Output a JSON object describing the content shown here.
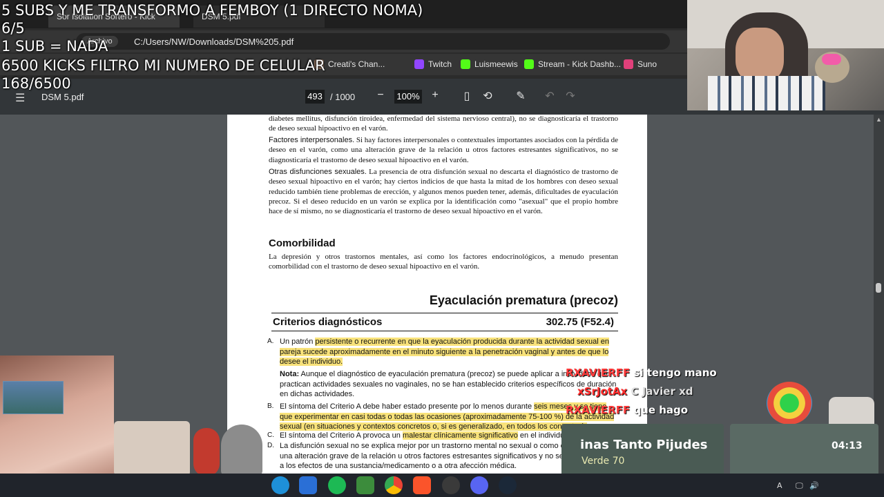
{
  "overlay": {
    "line1": "5 SUBS Y ME TRANSFORMO A FEMBOY (1 DIRECTO NOMA)",
    "line2": "6/5",
    "line3": "1 SUB = NADA",
    "line4": "6500 KICKS FILTRO MI NUMERO DE CELULAR",
    "line5": "168/6500"
  },
  "browser": {
    "tab1": "Sor Isolation Sortero - Kick",
    "tab2": "DSM 5.pdf",
    "chip": "Archivo",
    "url": "C:/Users/NW/Downloads/DSM%205.pdf",
    "bookmarks": [
      "Creati's Chan...",
      "Twitch",
      "Luismeewis",
      "Stream - Kick Dashb...",
      "Suno"
    ]
  },
  "pdf_toolbar": {
    "title": "DSM 5.pdf",
    "page_current": "493",
    "page_total": "/ 1000",
    "zoom": "100%"
  },
  "pdf": {
    "p1": "diabetes mellitus, disfunción tiroidea, enfermedad del sistema nervioso central), no se diagnosticaría el trastorno de deseo sexual hipoactivo en el varón.",
    "p2_head": "Factores interpersonales.",
    "p2": " Si hay factores interpersonales o contextuales importantes asociados con la pérdida de deseo en el varón, como una alteración grave de la relación u otros factores estresantes significativos, no se diagnosticaría el trastorno de deseo sexual hipoactivo en el varón.",
    "p3_head": "Otras disfunciones sexuales.",
    "p3": "  La presencia de otra disfunción sexual no descarta el diagnóstico de trastorno de deseo sexual hipoactivo en el varón; hay ciertos indicios de que hasta la mitad de los hombres con deseo sexual reducido también tiene problemas de erección, y algunos menos pueden tener, además, dificultades de eyaculación precoz. Si el deseo reducido en un varón se explica por la identificación como \"asexual\" que el propio hombre hace de sí mismo, no se diagnosticaría el trastorno de deseo sexual hipoactivo en el varón.",
    "comorbidity_head": "Comorbilidad",
    "comorbidity": "La depresión y otros trastornos mentales, así como los factores endocrinológicos, a menudo presentan comorbilidad con el trastorno de deseo sexual hipoactivo en el varón.",
    "section_title": "Eyaculación prematura (precoz)",
    "criteria_label": "Criterios diagnósticos",
    "criteria_code": "302.75 (F52.4)",
    "a_letter": "A.",
    "a_pre": "Un patrón ",
    "a_hl": "persistente o recurrente en que la eyaculación producida durante la actividad sexual en pareja sucede aproximadamente en el minuto siguiente a la penetración vaginal y antes de que lo desee el individuo.",
    "nota_head": "Nota:",
    "nota": " Aunque el diagnóstico de eyaculación prematura (precoz) se puede aplicar a individuos que practican actividades sexuales no vaginales, no se han establecido criterios específicos de duración en dichas actividades.",
    "b_letter": "B.",
    "b_pre": "El síntoma del Criterio A debe haber estado presente por lo menos durante ",
    "b_hl": "seis meses y se tiene que experimentar en casi todas o todas las ocasiones (aproximadamente 75-100 %) de la actividad sexual (en situaciones y contextos concretos o, si es generalizado, en todos los contextos).",
    "c_letter": "C.",
    "c_pre": "El síntoma del Criterio A provoca un ",
    "c_hl": "malestar clínicamente significativo",
    "c_post": " en el individuo.",
    "d_letter": "D.",
    "d": "La disfunción sexual no se explica mejor por un trastorno mental no sexual o como consecuencia de una alteración grave de la relación u otros factores estresantes significativos y no se puede atribuir a los efectos de una sustancia/medicamento o a otra afección médica."
  },
  "chat": [
    {
      "user": "RXAVIERFF",
      "msg": "si tengo mano"
    },
    {
      "user": "xSrJotAx",
      "msg": "C Javier xd"
    },
    {
      "user": "RXAVIERFF",
      "msg": "que hago"
    }
  ],
  "widget": {
    "title": "inas Tanto Pijudes",
    "subtitle": "Verde 70",
    "timer": "04:13"
  },
  "colors": {
    "highlight": "#f8e27a",
    "chat_user": "#ff3b3b",
    "pdf_toolbar": "#323639"
  }
}
